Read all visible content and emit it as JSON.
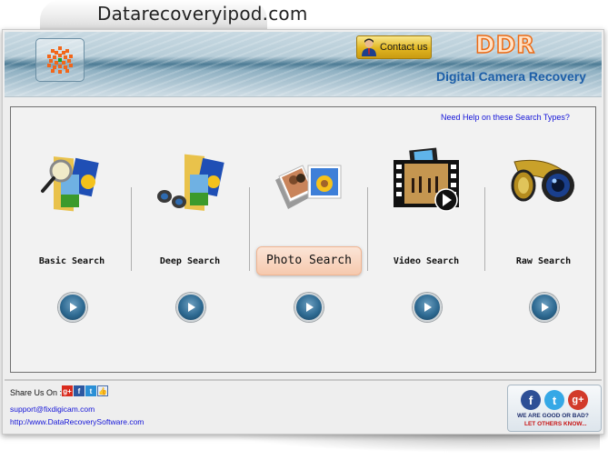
{
  "site": {
    "title": "Datarecoveryipod.com"
  },
  "header": {
    "logo_icon": "ddr-logo-icon",
    "contact_button": {
      "label": "Contact us",
      "icon": "person-icon"
    },
    "brand": "DDR",
    "product_name": "Digital Camera Recovery",
    "colors": {
      "brand_orange": "#ec6b16",
      "subtitle_blue": "#1c5ea8"
    }
  },
  "main": {
    "help_link": "Need Help on these Search Types?",
    "options": [
      {
        "label": "Basic Search",
        "icon": "folder-magnifier-icon",
        "selected": false
      },
      {
        "label": "Deep Search",
        "icon": "folder-binoculars-icon",
        "selected": false
      },
      {
        "label": "Photo Search",
        "icon": "photo-stack-icon",
        "selected": true
      },
      {
        "label": "Video Search",
        "icon": "film-strip-play-icon",
        "selected": false
      },
      {
        "label": "Raw Search",
        "icon": "film-reel-lens-icon",
        "selected": false
      }
    ],
    "selected_color": "#f6c9ae"
  },
  "footer": {
    "share_label": "Share Us On :",
    "share_icons": [
      "google-plus-icon",
      "facebook-icon",
      "twitter-icon",
      "like-icon"
    ],
    "email": "support@fixdigicam.com",
    "website": "http://www.DataRecoverySoftware.com",
    "social_box": {
      "icons": [
        "facebook-icon",
        "twitter-icon",
        "google-plus-icon"
      ],
      "line1": "WE ARE GOOD OR BAD?",
      "line2": "LET OTHERS KNOW..."
    }
  }
}
